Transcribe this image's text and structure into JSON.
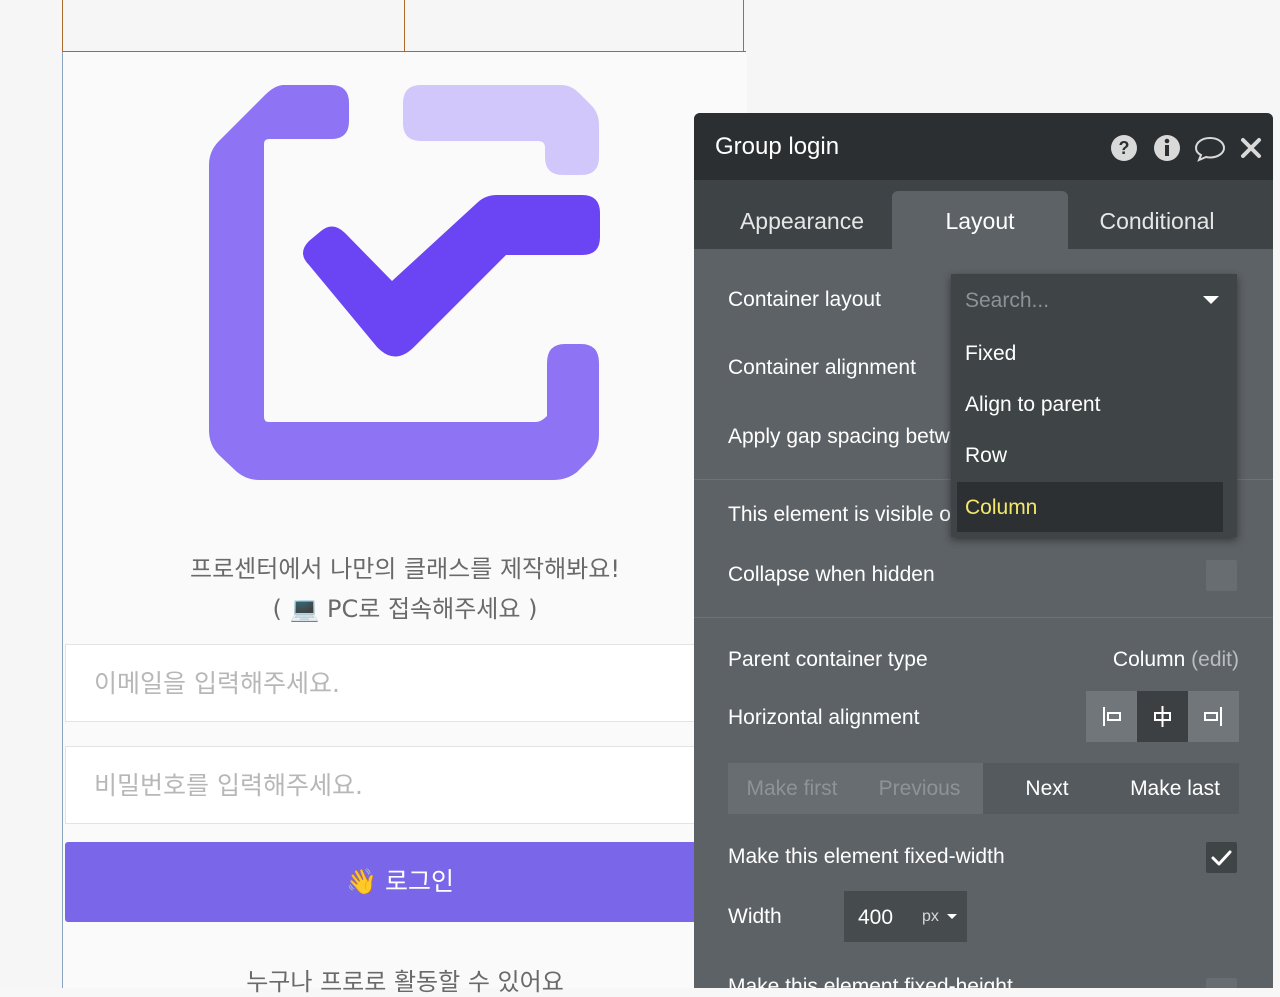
{
  "app_preview": {
    "tagline_line1": "프로센터에서 나만의 클래스를 제작해봐요!",
    "tagline_line2": "( 💻 PC로 접속해주세요 )",
    "email_placeholder": "이메일을 입력해주세요.",
    "password_placeholder": "비밀번호를 입력해주세요.",
    "login_button": "👋 로그인",
    "bottom_note": "누구나 프로로 활동할 수 있어요",
    "logo_colors": {
      "primary": "#8e73f5",
      "light": "#d2c7fb",
      "check": "#6b44f4"
    }
  },
  "panel": {
    "title": "Group login",
    "header_icons": [
      "help-icon",
      "info-icon",
      "comment-icon",
      "close-icon"
    ],
    "tabs": [
      {
        "label": "Appearance",
        "active": false
      },
      {
        "label": "Layout",
        "active": true
      },
      {
        "label": "Conditional",
        "active": false
      }
    ],
    "container_layout_label": "Container layout",
    "container_alignment_label": "Container alignment",
    "gap_spacing_label": "Apply gap spacing betw",
    "visible_label": "This element is visible o",
    "collapse_label": "Collapse when hidden",
    "layout_dropdown": {
      "placeholder": "Search...",
      "options": [
        "Fixed",
        "Align to parent",
        "Row",
        "Column"
      ],
      "highlighted": "Column"
    },
    "parent_container_label": "Parent container type",
    "parent_container_value": "Column",
    "parent_container_edit": "(edit)",
    "horizontal_alignment_label": "Horizontal alignment",
    "horizontal_alignment_selected": "center",
    "order_buttons": {
      "make_first": "Make first",
      "previous": "Previous",
      "next": "Next",
      "make_last": "Make last"
    },
    "fixed_width_label": "Make this element fixed-width",
    "fixed_width_checked": true,
    "width_label": "Width",
    "width_value": "400",
    "width_unit": "px",
    "next_row_partial": "Make this element fixed-height"
  }
}
